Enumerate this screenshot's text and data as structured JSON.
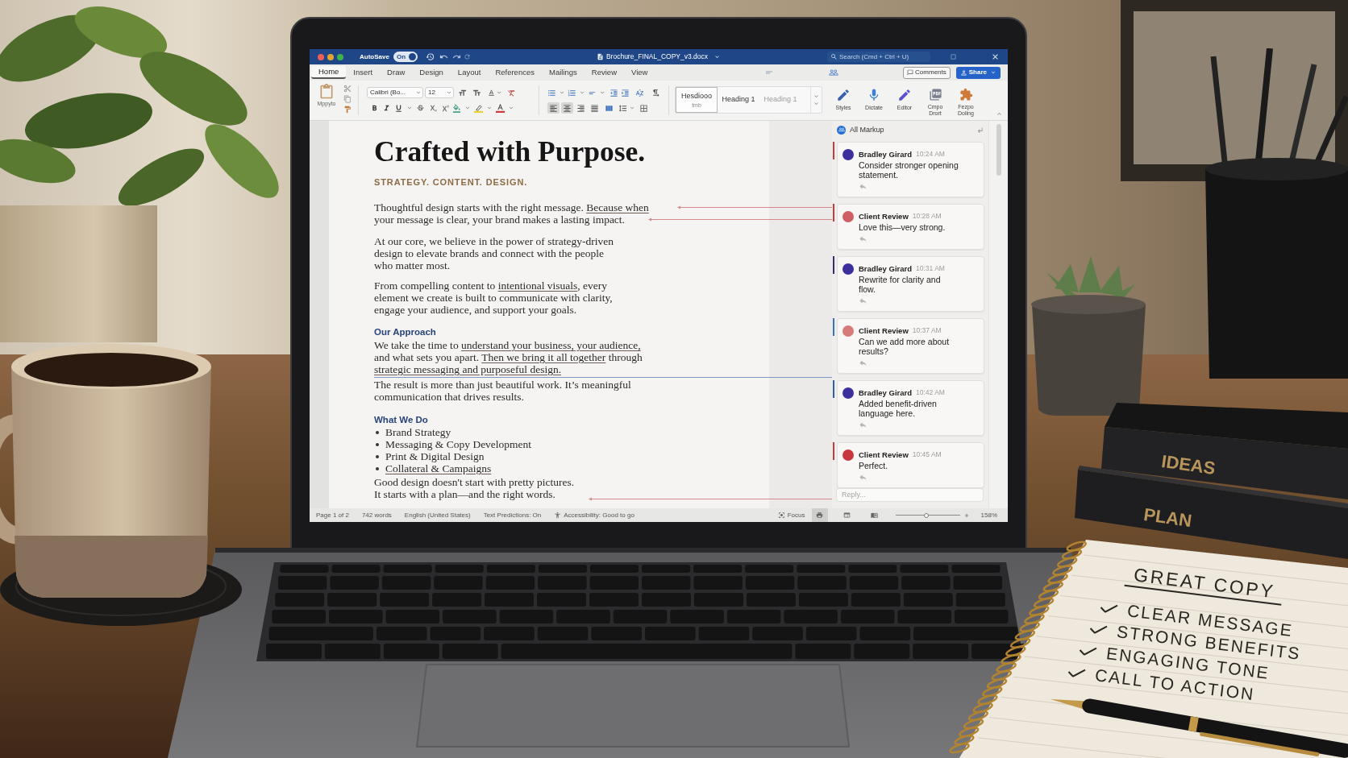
{
  "window": {
    "title": "Brochure_FINAL_COPY_v3.docx",
    "autosave": {
      "label": "AutoSave",
      "on": true,
      "state": "On"
    },
    "search": {
      "placeholder": "Search (Cmd + Ctrl + U)"
    }
  },
  "tabs": [
    {
      "label": "Home",
      "selected": true
    },
    {
      "label": "Insert",
      "selected": false
    },
    {
      "label": "Draw",
      "selected": false
    },
    {
      "label": "Design",
      "selected": false
    },
    {
      "label": "Layout",
      "selected": false
    },
    {
      "label": "References",
      "selected": false
    },
    {
      "label": "Mailings",
      "selected": false
    },
    {
      "label": "Review",
      "selected": false
    },
    {
      "label": "View",
      "selected": false
    }
  ],
  "header_buttons": [
    {
      "kind": "comments",
      "label": "Comments"
    },
    {
      "kind": "share",
      "label": "Share"
    }
  ],
  "ribbon": {
    "paste": {
      "label": "Mppyto"
    },
    "font": {
      "name": "Calibri (Bo...",
      "size": "12"
    },
    "alignment": [
      {
        "selected": true
      },
      {
        "selected": true
      },
      {
        "selected": false
      },
      {
        "selected": false
      }
    ],
    "styles": [
      {
        "label": "Hesdiooo",
        "note": "tmb",
        "selected": true,
        "disabled": false
      },
      {
        "label": "Heading 1",
        "selected": false,
        "disabled": false
      },
      {
        "label": "Heading 1",
        "selected": false,
        "disabled": true
      }
    ],
    "tools": [
      {
        "kind": "styles",
        "label": "Styles"
      },
      {
        "kind": "dictate",
        "label": "Dictate"
      },
      {
        "kind": "editor",
        "label": "Editor"
      },
      {
        "kind": "convert",
        "label": "Cmpo Drort"
      },
      {
        "kind": "addin",
        "label": "Fezpo Doling"
      }
    ]
  },
  "doc": {
    "title": "Crafted with Purpose.",
    "subtitle": "STRATEGY. CONTENT. DESIGN.",
    "blocks": [
      {
        "kind": "paragraph",
        "lines": [
          [
            {
              "text": "Thoughtful design starts with the right message. ",
              "underlined": false
            },
            {
              "text": "Because when",
              "underlined": true
            }
          ],
          [
            {
              "text": "your message is clear, your brand makes a lasting impact.",
              "underlined": false
            }
          ]
        ]
      },
      {
        "kind": "paragraph",
        "lines": [
          [
            {
              "text": "At our core, we believe in the power of strategy-driven",
              "underlined": false
            }
          ],
          [
            {
              "text": "design to elevate brands and connect with the people",
              "underlined": false
            }
          ],
          [
            {
              "text": "who matter most.",
              "underlined": false
            }
          ]
        ]
      },
      {
        "kind": "paragraph",
        "lines": [
          [
            {
              "text": "From compelling content to ",
              "underlined": false
            },
            {
              "text": "intentional visuals",
              "underlined": true
            },
            {
              "text": ", every",
              "underlined": false
            }
          ],
          [
            {
              "text": "element we create is built to communicate with clarity,",
              "underlined": false
            }
          ],
          [
            {
              "text": "engage your audience, and support your goals.",
              "underlined": false
            }
          ]
        ]
      },
      {
        "kind": "heading",
        "text": "Our Approach"
      },
      {
        "kind": "paragraph",
        "lines": [
          [
            {
              "text": "We take the time to ",
              "underlined": false
            },
            {
              "text": "understand your business, your audience,",
              "underlined": true
            }
          ],
          [
            {
              "text": "and what sets you apart. ",
              "underlined": false
            },
            {
              "text": "Then we bring it all together",
              "underlined": true
            },
            {
              "text": " through",
              "underlined": false
            }
          ],
          [
            {
              "text": "strategic messaging and purposeful design.",
              "underlined": true
            }
          ]
        ]
      },
      {
        "kind": "paragraph",
        "lines": [
          [
            {
              "text": "The result is more than just beautiful work. It’s meaningful",
              "underlined": false
            }
          ],
          [
            {
              "text": "communication that drives results.",
              "underlined": false
            }
          ]
        ]
      },
      {
        "kind": "heading",
        "text": "What We Do"
      },
      {
        "kind": "bullets",
        "items": [
          {
            "text": "Brand Strategy",
            "underlined": false
          },
          {
            "text": "Messaging & Copy Development",
            "underlined": false
          },
          {
            "text": "Print & Digital Design",
            "underlined": false
          },
          {
            "text": "Collateral & Campaigns",
            "underlined": true
          }
        ]
      },
      {
        "kind": "paragraph",
        "lines": [
          [
            {
              "text": "Good design doesn't start with pretty pictures.",
              "underlined": false
            }
          ],
          [
            {
              "text": "It starts with a plan—and the right words.",
              "underlined": false
            }
          ]
        ]
      }
    ]
  },
  "comments": {
    "filter": "All Markup",
    "items": [
      {
        "author": "Bradley Girard",
        "time": "10:24 AM",
        "lines": [
          "Consider stronger opening",
          "statement."
        ],
        "avatar": {
          "color": "#3b2f9e"
        },
        "bar": {
          "color": "#c43c3c"
        }
      },
      {
        "author": "Client Review",
        "time": "10:28 AM",
        "lines": [
          "Love this—very strong."
        ],
        "avatar": {
          "color": "#cf5f64"
        },
        "bar": {
          "color": "#c43c3c"
        }
      },
      {
        "author": "Bradley Girard",
        "time": "10:31 AM",
        "lines": [
          "Rewrite for clarity and",
          "flow."
        ],
        "avatar": {
          "color": "#3b2f9e"
        },
        "bar": {
          "color": "#3d2a6e"
        }
      },
      {
        "author": "Client Review",
        "time": "10:37 AM",
        "lines": [
          "Can we add more about",
          "results?"
        ],
        "avatar": {
          "color": "#d77a7a"
        },
        "bar": {
          "color": "#3b6fc4"
        }
      },
      {
        "author": "Bradley Girard",
        "time": "10:42 AM",
        "lines": [
          "Added benefit-driven",
          "language here."
        ],
        "avatar": {
          "color": "#3b2f9e"
        },
        "bar": {
          "color": "#2c5fb5"
        }
      },
      {
        "author": "Client Review",
        "time": "10:45 AM",
        "lines": [
          "Perfect."
        ],
        "avatar": {
          "color": "#c8373f"
        },
        "bar": {
          "color": "#c43c3c"
        }
      }
    ],
    "reply": {
      "placeholder": "Reply..."
    }
  },
  "status_bar": {
    "items": [
      {
        "kind": "text",
        "label": "Page 1 of 2"
      },
      {
        "kind": "text",
        "label": "742 words"
      },
      {
        "kind": "text",
        "label": "English (United States)"
      },
      {
        "kind": "text",
        "label": "Text Predictions: On"
      },
      {
        "kind": "accessibility",
        "label": "Accessibility: Good to go"
      }
    ],
    "focus": "Focus",
    "views": [
      {
        "selected": true
      },
      {
        "selected": false
      },
      {
        "selected": false
      }
    ],
    "zoom": {
      "level": 0.48,
      "reading": "158%"
    }
  },
  "books": [
    {
      "title": "IDEAS"
    },
    {
      "title": "PLAN"
    }
  ],
  "notebook": {
    "heading": "GREAT COPY",
    "items": [
      {
        "text": "CLEAR MESSAGE",
        "checked": true
      },
      {
        "text": "STRONG BENEFITS",
        "checked": true
      },
      {
        "text": "ENGAGING TONE",
        "checked": true
      },
      {
        "text": "CALL TO ACTION",
        "checked": true
      }
    ]
  }
}
